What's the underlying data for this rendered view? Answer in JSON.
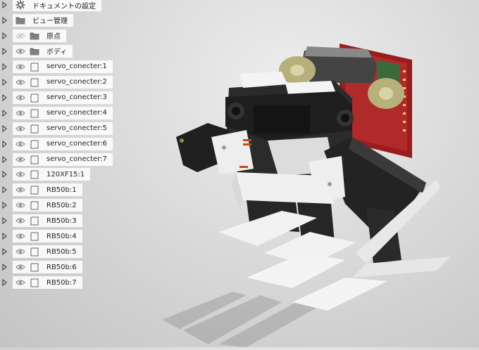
{
  "browser": {
    "items": [
      {
        "label": "ドキュメントの設定",
        "icon": "gear-icon",
        "eye": false
      },
      {
        "label": "ビュー管理",
        "icon": "folder-icon",
        "eye": false
      },
      {
        "label": "原点",
        "icon": "folder-icon",
        "eye": true,
        "eye_hidden": true
      },
      {
        "label": "ボディ",
        "icon": "folder-icon",
        "eye": true
      },
      {
        "label": "servo_conecter:1",
        "icon": "component-icon",
        "eye": true
      },
      {
        "label": "servo_conecter:2",
        "icon": "component-icon",
        "eye": true
      },
      {
        "label": "servo_conecter:3",
        "icon": "component-icon",
        "eye": true
      },
      {
        "label": "servo_conecter:4",
        "icon": "component-icon",
        "eye": true
      },
      {
        "label": "servo_conecter:5",
        "icon": "component-icon",
        "eye": true
      },
      {
        "label": "servo_conecter:6",
        "icon": "component-icon",
        "eye": true
      },
      {
        "label": "servo_conecter:7",
        "icon": "component-icon",
        "eye": true
      },
      {
        "label": "120XF15:1",
        "icon": "component-icon",
        "eye": true
      },
      {
        "label": "RB50b:1",
        "icon": "component-icon",
        "eye": true
      },
      {
        "label": "RB50b:2",
        "icon": "component-icon",
        "eye": true
      },
      {
        "label": "RB50b:3",
        "icon": "component-icon",
        "eye": true
      },
      {
        "label": "RB50b:4",
        "icon": "component-icon",
        "eye": true
      },
      {
        "label": "RB50b:5",
        "icon": "component-icon",
        "eye": true
      },
      {
        "label": "RB50b:6",
        "icon": "component-icon",
        "eye": true
      },
      {
        "label": "RB50b:7",
        "icon": "component-icon",
        "eye": true
      }
    ]
  },
  "colors": {
    "background": "#d6d6d6",
    "label_bg": "#ffffff",
    "icon_gray": "#7a7a7a",
    "body_dark": "#2b2b2b",
    "plate_white": "#f2f2f2",
    "pcb_red": "#a02020",
    "servo_khaki": "#b8b07a"
  },
  "viewport": {
    "subject": "robot-model"
  }
}
